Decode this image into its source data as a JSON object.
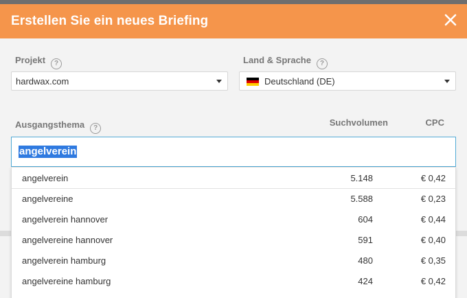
{
  "dialog": {
    "title": "Erstellen Sie ein neues Briefing"
  },
  "project": {
    "label": "Projekt",
    "help": "?",
    "value": "hardwax.com"
  },
  "country": {
    "label": "Land & Sprache",
    "help": "?",
    "value": "Deutschland (DE)",
    "flag_colors": [
      "#000000",
      "#dd0000",
      "#ffce00"
    ]
  },
  "topic": {
    "label": "Ausgangsthema",
    "help": "?",
    "value": "angelverein",
    "col_volume": "Suchvolumen",
    "col_cpc": "CPC"
  },
  "suggestions": [
    {
      "keyword": "angelverein",
      "volume": "5.148",
      "cpc": "€ 0,42"
    },
    {
      "keyword": "angelvereine",
      "volume": "5.588",
      "cpc": "€ 0,23"
    },
    {
      "keyword": "angelverein hannover",
      "volume": "604",
      "cpc": "€ 0,44"
    },
    {
      "keyword": "angelvereine hannover",
      "volume": "591",
      "cpc": "€ 0,40"
    },
    {
      "keyword": "angelverein hamburg",
      "volume": "480",
      "cpc": "€ 0,35"
    },
    {
      "keyword": "angelvereine hamburg",
      "volume": "424",
      "cpc": "€ 0,42"
    }
  ],
  "colors": {
    "header": "#f5954b",
    "focus_border": "#4fa9d6",
    "selection": "#2f7ae0"
  }
}
